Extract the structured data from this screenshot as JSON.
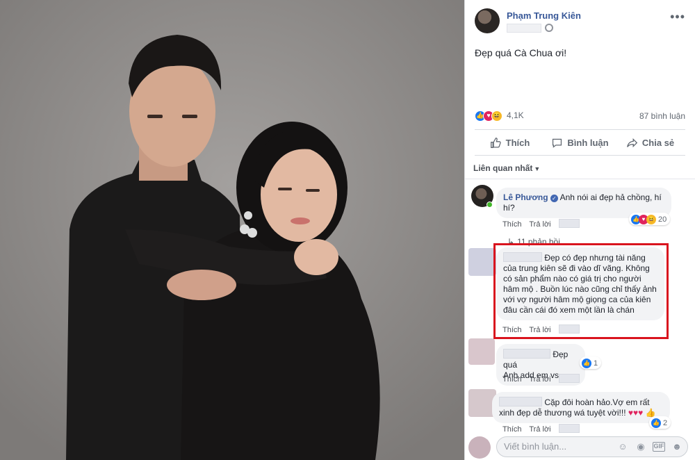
{
  "post": {
    "author": "Phạm Trung Kiên",
    "text": "Đẹp quá Cà Chua ơi!",
    "reaction_count": "4,1K",
    "comment_count": "87 bình luận"
  },
  "actions": {
    "like": "Thích",
    "comment": "Bình luận",
    "share": "Chia sẻ"
  },
  "sort_label": "Liên quan nhất",
  "comments": [
    {
      "name": "Lê Phương",
      "text": "Anh nói ai đẹp hả chồng, hí hí?",
      "like": "Thích",
      "reply": "Trả lời",
      "reaction_count": "20"
    },
    {
      "text": "Đẹp có đẹp nhưng tài năng của trung kiên sẽ đi vào dĩ vãng. Không có sản phẩm nào có giá trị cho người hâm mộ . Buồn lúc nào cũng chỉ thấy ảnh với vợ người hâm mộ giọng ca của kiên đâu cần cái đó xem một lần là chán",
      "like": "Thích",
      "reply": "Trả lời"
    },
    {
      "text1": "Đẹp quá",
      "text2": "Anh add em vs",
      "like": "Thích",
      "reply": "Trả lời",
      "reaction_count": "1"
    },
    {
      "text": "Cặp đôi hoàn hảo.Vợ em rất xinh đẹp dễ thương wá tuyệt vời!!!",
      "like": "Thích",
      "reply": "Trả lời",
      "reaction_count": "2"
    }
  ],
  "replies_label": "11 phản hồi",
  "composer": {
    "placeholder": "Viết bình luận..."
  },
  "colors": {
    "link": "#385898",
    "like_blue": "#1877f2",
    "love_red": "#e0245e",
    "highlight_red": "#d9141e"
  }
}
